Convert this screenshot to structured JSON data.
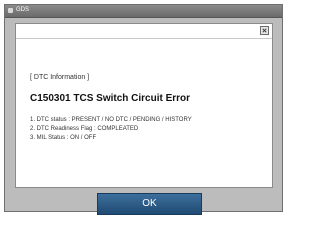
{
  "window": {
    "title": "GDS"
  },
  "dialog": {
    "header": "[ DTC Information ]",
    "error_title": "C150301 TCS Switch Circuit Error",
    "lines": [
      "1. DTC status : PRESENT / NO DTC / PENDING / HISTORY",
      "2. DTC Readiness Flag : COMPLEATED",
      "3. MIL Status : ON / OFF"
    ],
    "ok_label": "OK"
  },
  "colors": {
    "titlebar": "#6f6f6f",
    "window_bg": "#bcbcbc",
    "panel_bg": "#ffffff",
    "ok_button": "#2b5c87"
  },
  "icons": [
    "app-icon",
    "close-icon"
  ]
}
